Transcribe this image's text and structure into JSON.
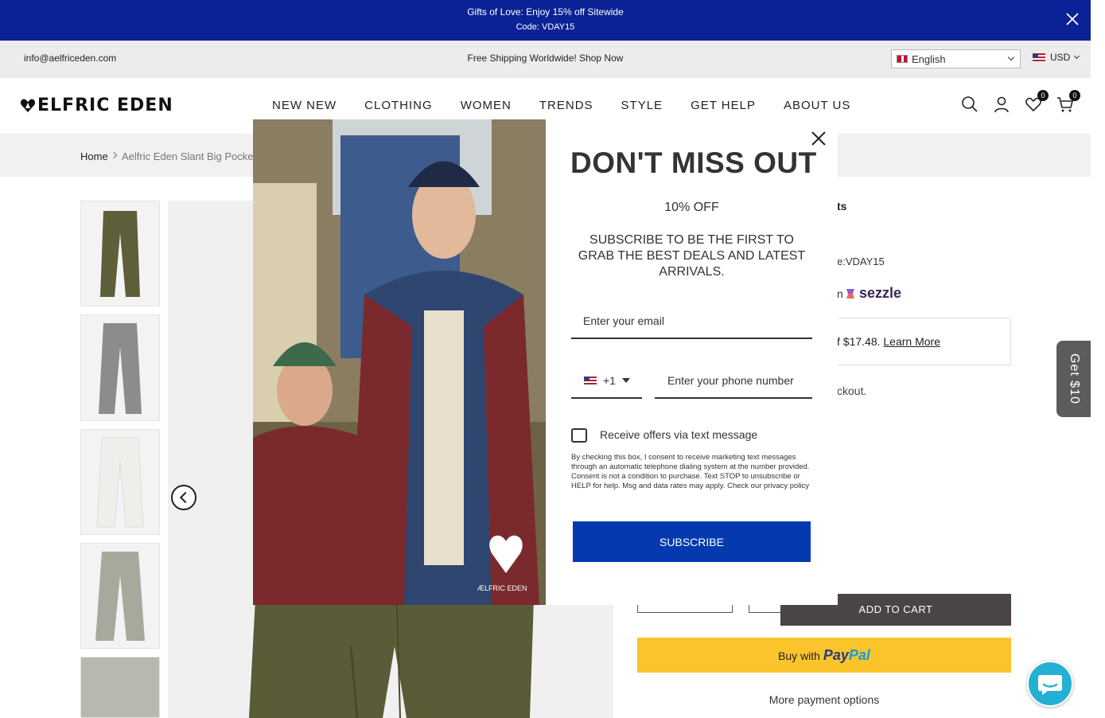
{
  "announcement": {
    "line1": "Gifts of Love: Enjoy 15% off Sitewide",
    "line2": "Code: VDAY15"
  },
  "topbar": {
    "email": "info@aelfriceden.com",
    "shipping": "Free Shipping Worldwide! Shop Now",
    "language": "English",
    "currency": "USD"
  },
  "header": {
    "logo": "ELFRIC EDEN",
    "nav": [
      "NEW NEW",
      "CLOTHING",
      "WOMEN",
      "TRENDS",
      "STYLE",
      "GET HELP",
      "ABOUT US"
    ],
    "wishlist_count": "0",
    "cart_count": "0"
  },
  "breadcrumb": {
    "home": "Home",
    "current": "Aelfric Eden Slant Big Pocket C"
  },
  "product": {
    "title_fragment": "ts",
    "code_fragment": "e:VDAY15",
    "sezzle_prefix": "n",
    "sezzle_label": "sezzle",
    "klarna_text": "f $17.48.",
    "klarna_link": "Learn More",
    "checkout_fragment": "ckout.",
    "add_to_cart": "ADD TO CART",
    "paypal_prefix": "Buy with",
    "paypal_pay": "Pay",
    "paypal_pal": "Pal",
    "more_payment": "More payment options",
    "thumbnail_colors": [
      "#5e5e3a",
      "#8c8c8a",
      "#eeeeea",
      "#a8a89c",
      "#9a9a92"
    ]
  },
  "sidetab": {
    "label": "Get $10"
  },
  "modal": {
    "title": "DON'T MISS OUT",
    "offer": "10% OFF",
    "subtitle": "SUBSCRIBE TO BE THE FIRST TO GRAB THE BEST DEALS AND LATEST ARRIVALS.",
    "email_placeholder": "Enter your email",
    "country_code": "+1",
    "phone_placeholder": "Enter your phone number",
    "checkbox_label": "Receive offers via text message",
    "legal": "By checking this box, I consent to receive marketing text messages through an automatic telephone dialing system at the number provided. Consent is not a condition to purchase. Text STOP to unsubscribe or HELP for help. Msg and data rates may apply. Check our privacy policy",
    "subscribe": "SUBSCRIBE",
    "image_logo": "ÆLFRIC EDEN"
  },
  "colors": {
    "announce_bg": "#0a2295",
    "subscribe_bg": "#0439b0",
    "cart_bg": "#4a4445",
    "paypal_bg": "#fbc42d",
    "chat_bg": "#24b0d4"
  }
}
